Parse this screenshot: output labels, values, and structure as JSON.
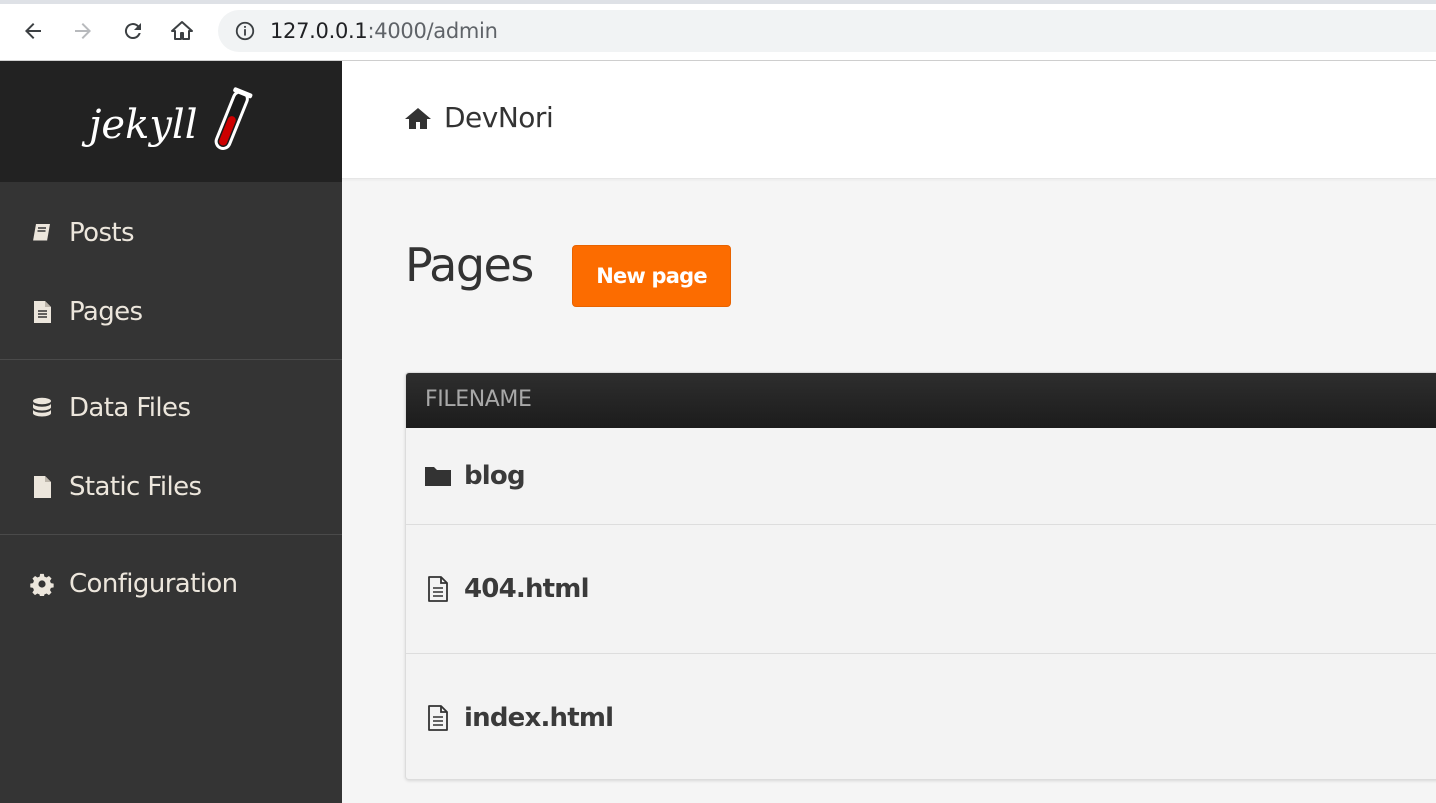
{
  "browser": {
    "url_host": "127.0.0.1",
    "url_path": ":4000/admin"
  },
  "sidebar": {
    "logo_text": "jekyll",
    "items": [
      {
        "label": "Posts",
        "icon": "book-icon"
      },
      {
        "label": "Pages",
        "icon": "file-text-icon"
      },
      {
        "label": "Data Files",
        "icon": "database-icon"
      },
      {
        "label": "Static Files",
        "icon": "file-icon"
      },
      {
        "label": "Configuration",
        "icon": "gear-icon"
      }
    ]
  },
  "header": {
    "site_name": "DevNori",
    "icon": "home-icon"
  },
  "main": {
    "title": "Pages",
    "new_button_label": "New page",
    "table": {
      "column_header": "FILENAME",
      "rows": [
        {
          "name": "blog",
          "icon": "folder-icon"
        },
        {
          "name": "404.html",
          "icon": "file-outline-icon"
        },
        {
          "name": "index.html",
          "icon": "file-outline-icon"
        }
      ]
    }
  },
  "colors": {
    "accent": "#fc6c00",
    "sidebar_bg": "#343434",
    "logo_bg": "#222222",
    "table_header_bg": "#1c1c1c"
  }
}
